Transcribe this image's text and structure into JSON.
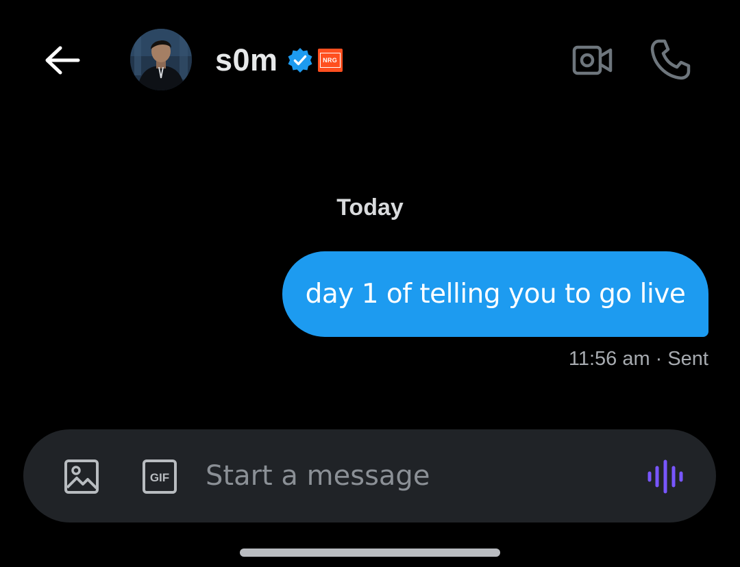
{
  "header": {
    "username": "s0m",
    "affiliate_badge_text": "NRG",
    "verified_color": "#1d9bf0",
    "affiliate_color": "#ff4f1f",
    "icons": {
      "back": "arrow-left-icon",
      "verified": "verified-badge-icon",
      "affiliate": "affiliate-badge-icon",
      "video": "video-camera-icon",
      "phone": "phone-icon"
    }
  },
  "conversation": {
    "day_label": "Today",
    "messages": [
      {
        "direction": "outgoing",
        "text": "day 1 of telling you to go live",
        "time": "11:56 am",
        "separator": "·",
        "status": "Sent"
      }
    ],
    "bubble_color": "#1d9bf0"
  },
  "composer": {
    "placeholder": "Start a message",
    "value": "",
    "icons": {
      "media": "image-icon",
      "gif": "gif-icon",
      "voice": "voice-waveform-icon"
    },
    "accent_color": "#7856ff"
  }
}
